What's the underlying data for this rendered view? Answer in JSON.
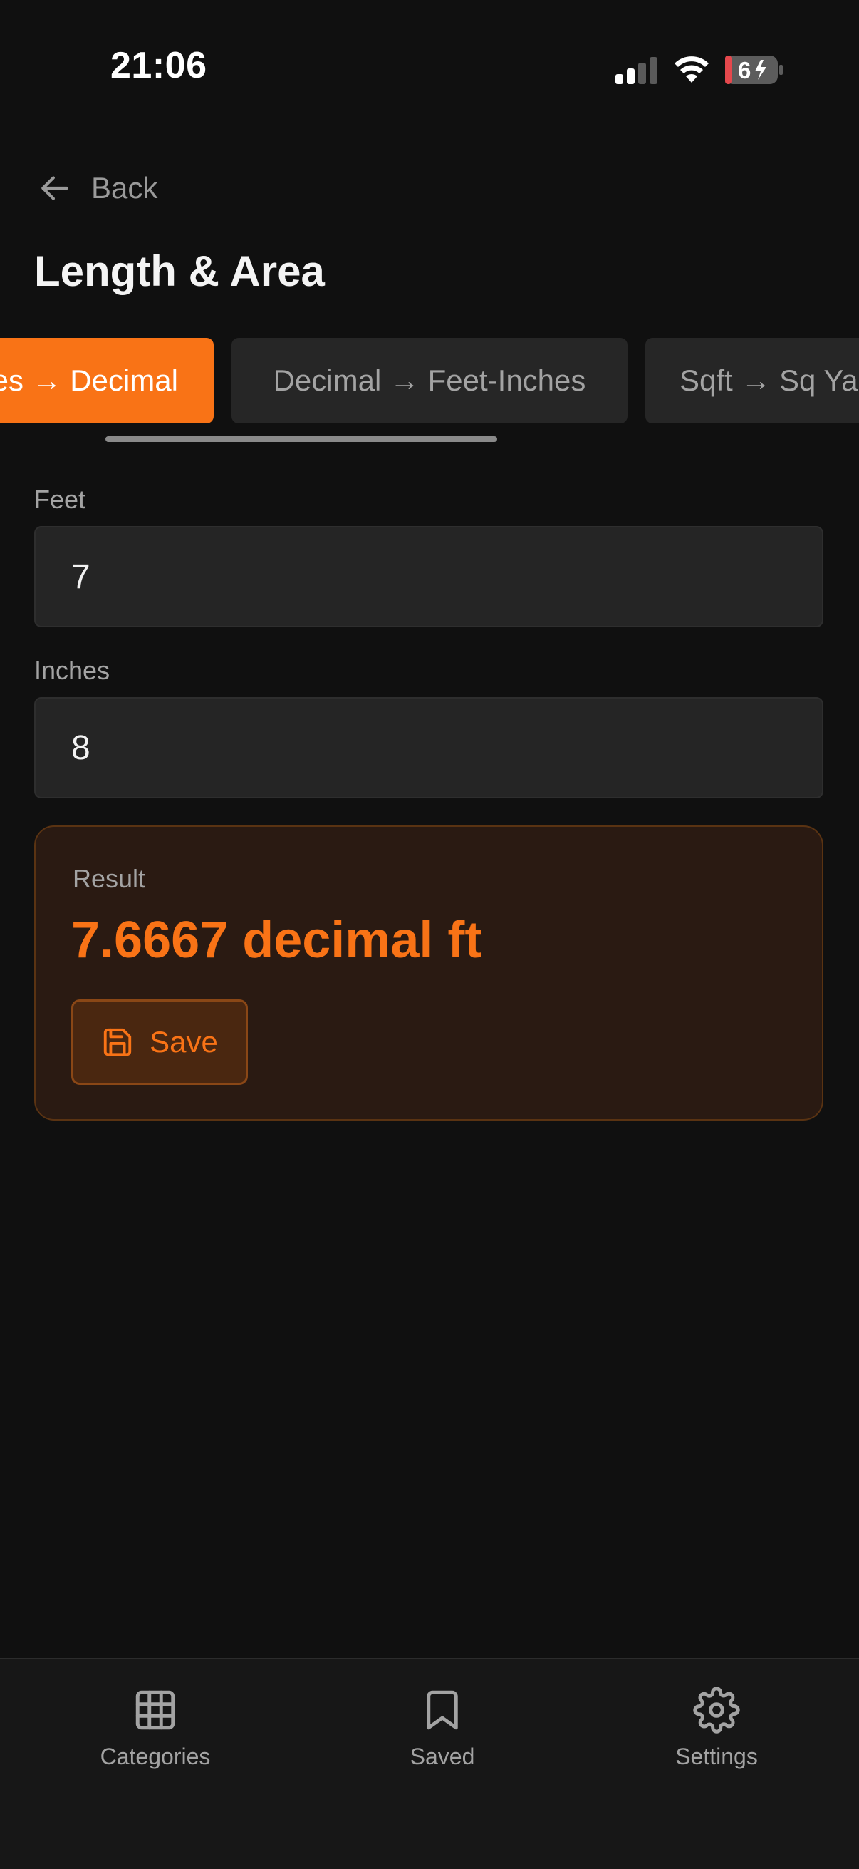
{
  "status_bar": {
    "time": "21:06",
    "battery_level": "6",
    "icons": [
      "signal-icon",
      "wifi-icon",
      "battery-charging-icon"
    ]
  },
  "header": {
    "back_label": "Back",
    "title": "Length & Area"
  },
  "tabs": [
    {
      "label": "es → Decimal",
      "active": true
    },
    {
      "label": "Decimal → Feet-Inches",
      "active": false
    },
    {
      "label": "Sqft → Sq Ya",
      "active": false
    }
  ],
  "form": {
    "feet_label": "Feet",
    "feet_value": "7",
    "inches_label": "Inches",
    "inches_value": "8"
  },
  "result": {
    "label": "Result",
    "value": "7.6667 decimal ft",
    "save_label": "Save"
  },
  "bottom_nav": [
    {
      "label": "Categories",
      "icon": "grid-icon"
    },
    {
      "label": "Saved",
      "icon": "bookmark-icon"
    },
    {
      "label": "Settings",
      "icon": "gear-icon"
    }
  ],
  "colors": {
    "accent": "#f97316",
    "background": "#101010",
    "surface": "#252525",
    "result_surface": "#2a1a12",
    "battery_low": "#e5484d"
  }
}
